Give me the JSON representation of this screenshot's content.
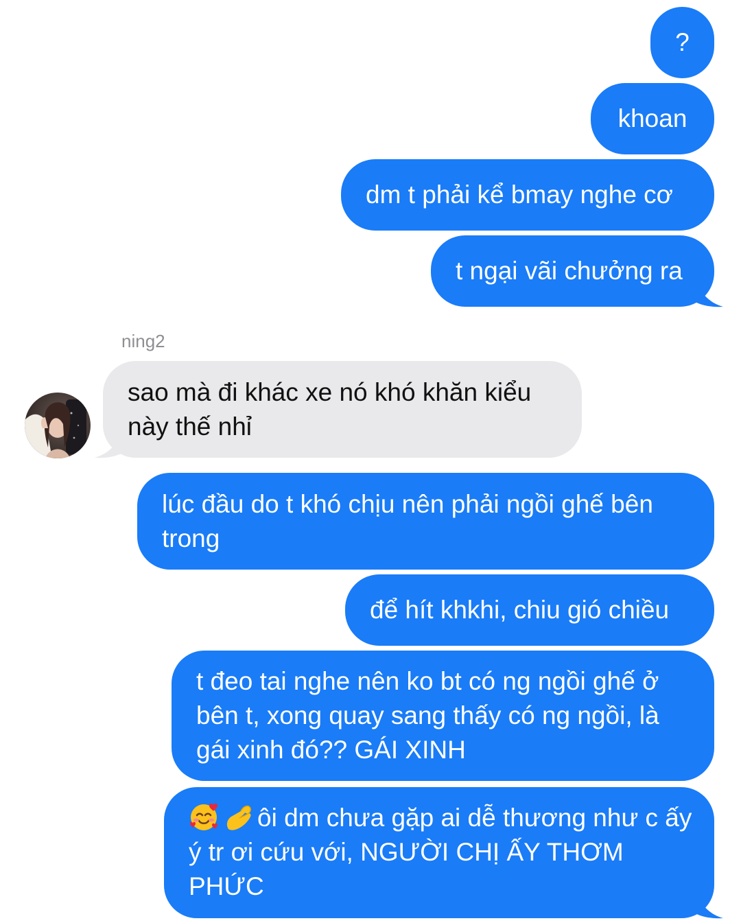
{
  "colors": {
    "outgoing_bubble": "#1a7cf7",
    "incoming_bubble": "#e9e9eb",
    "sender_name": "#8e8e93"
  },
  "messages": {
    "m1": "?",
    "m2": "khoan",
    "m3": "dm t phải kể bmay nghe cơ",
    "m4": "t ngại vãi chưởng ra",
    "sender": "ning2",
    "m5": "sao mà đi khác xe nó khó khăn kiểu này thế nhỉ",
    "m6": "lúc đầu do t khó chịu nên phải ngồi ghế bên trong",
    "m7": "để hít khkhi, chiu gió chiều",
    "m8": "t đeo tai nghe nên ko bt có ng ngồi ghế ở bên t, xong quay sang thấy có ng ngồi, là gái xinh đó?? GÁI XINH",
    "m9_emojis": [
      "smiling-face-with-hearts",
      "pinching-hand"
    ],
    "m9": "ôi dm chưa gặp ai dễ thương như c ấy ý tr ơi cứu với, NGƯỜI CHỊ ẤY THƠM PHỨC"
  }
}
